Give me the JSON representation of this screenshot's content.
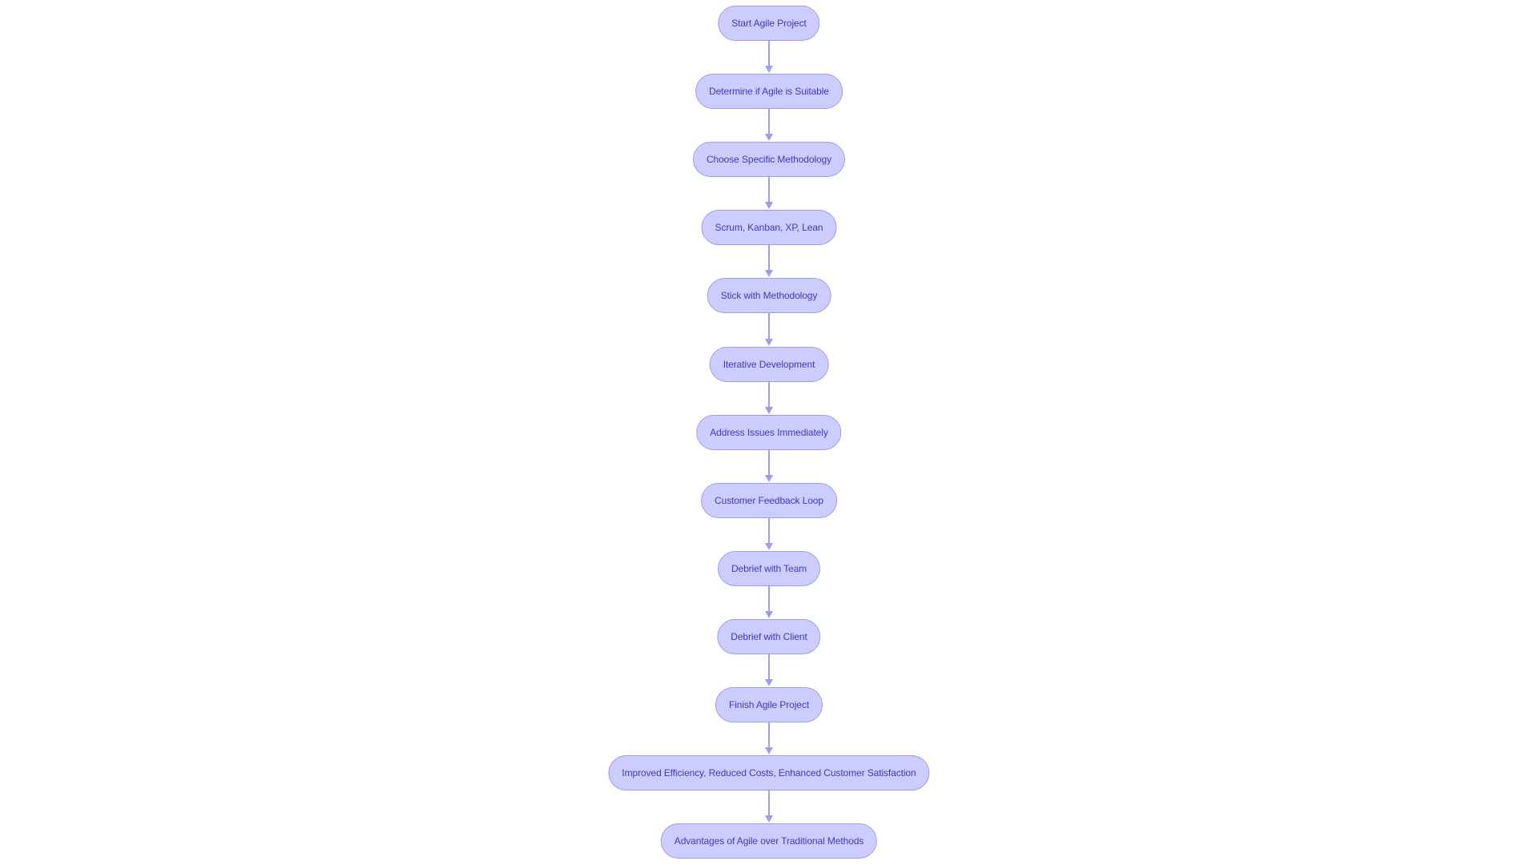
{
  "diagram": {
    "type": "flowchart",
    "direction": "top-down",
    "colors": {
      "node_fill": "#ccccff",
      "node_stroke": "#9e9ee8",
      "text": "#3b3bb3",
      "edge": "#9e9ee8"
    },
    "nodes": [
      {
        "id": "start",
        "label": "Start Agile Project"
      },
      {
        "id": "determine",
        "label": "Determine if Agile is Suitable"
      },
      {
        "id": "choose",
        "label": "Choose Specific Methodology"
      },
      {
        "id": "methods",
        "label": "Scrum, Kanban, XP, Lean"
      },
      {
        "id": "stick",
        "label": "Stick with Methodology"
      },
      {
        "id": "iterative",
        "label": "Iterative Development"
      },
      {
        "id": "address",
        "label": "Address Issues Immediately"
      },
      {
        "id": "feedback",
        "label": "Customer Feedback Loop"
      },
      {
        "id": "debrief-team",
        "label": "Debrief with Team"
      },
      {
        "id": "debrief-client",
        "label": "Debrief with Client"
      },
      {
        "id": "finish",
        "label": "Finish Agile Project"
      },
      {
        "id": "benefits",
        "label": "Improved Efficiency, Reduced Costs, Enhanced Customer Satisfaction"
      },
      {
        "id": "advantages",
        "label": "Advantages of Agile over Traditional Methods"
      }
    ],
    "edges": [
      {
        "from": "start",
        "to": "determine"
      },
      {
        "from": "determine",
        "to": "choose"
      },
      {
        "from": "choose",
        "to": "methods"
      },
      {
        "from": "methods",
        "to": "stick"
      },
      {
        "from": "stick",
        "to": "iterative"
      },
      {
        "from": "iterative",
        "to": "address"
      },
      {
        "from": "address",
        "to": "feedback"
      },
      {
        "from": "feedback",
        "to": "debrief-team"
      },
      {
        "from": "debrief-team",
        "to": "debrief-client"
      },
      {
        "from": "debrief-client",
        "to": "finish"
      },
      {
        "from": "finish",
        "to": "benefits"
      },
      {
        "from": "benefits",
        "to": "advantages"
      }
    ]
  }
}
